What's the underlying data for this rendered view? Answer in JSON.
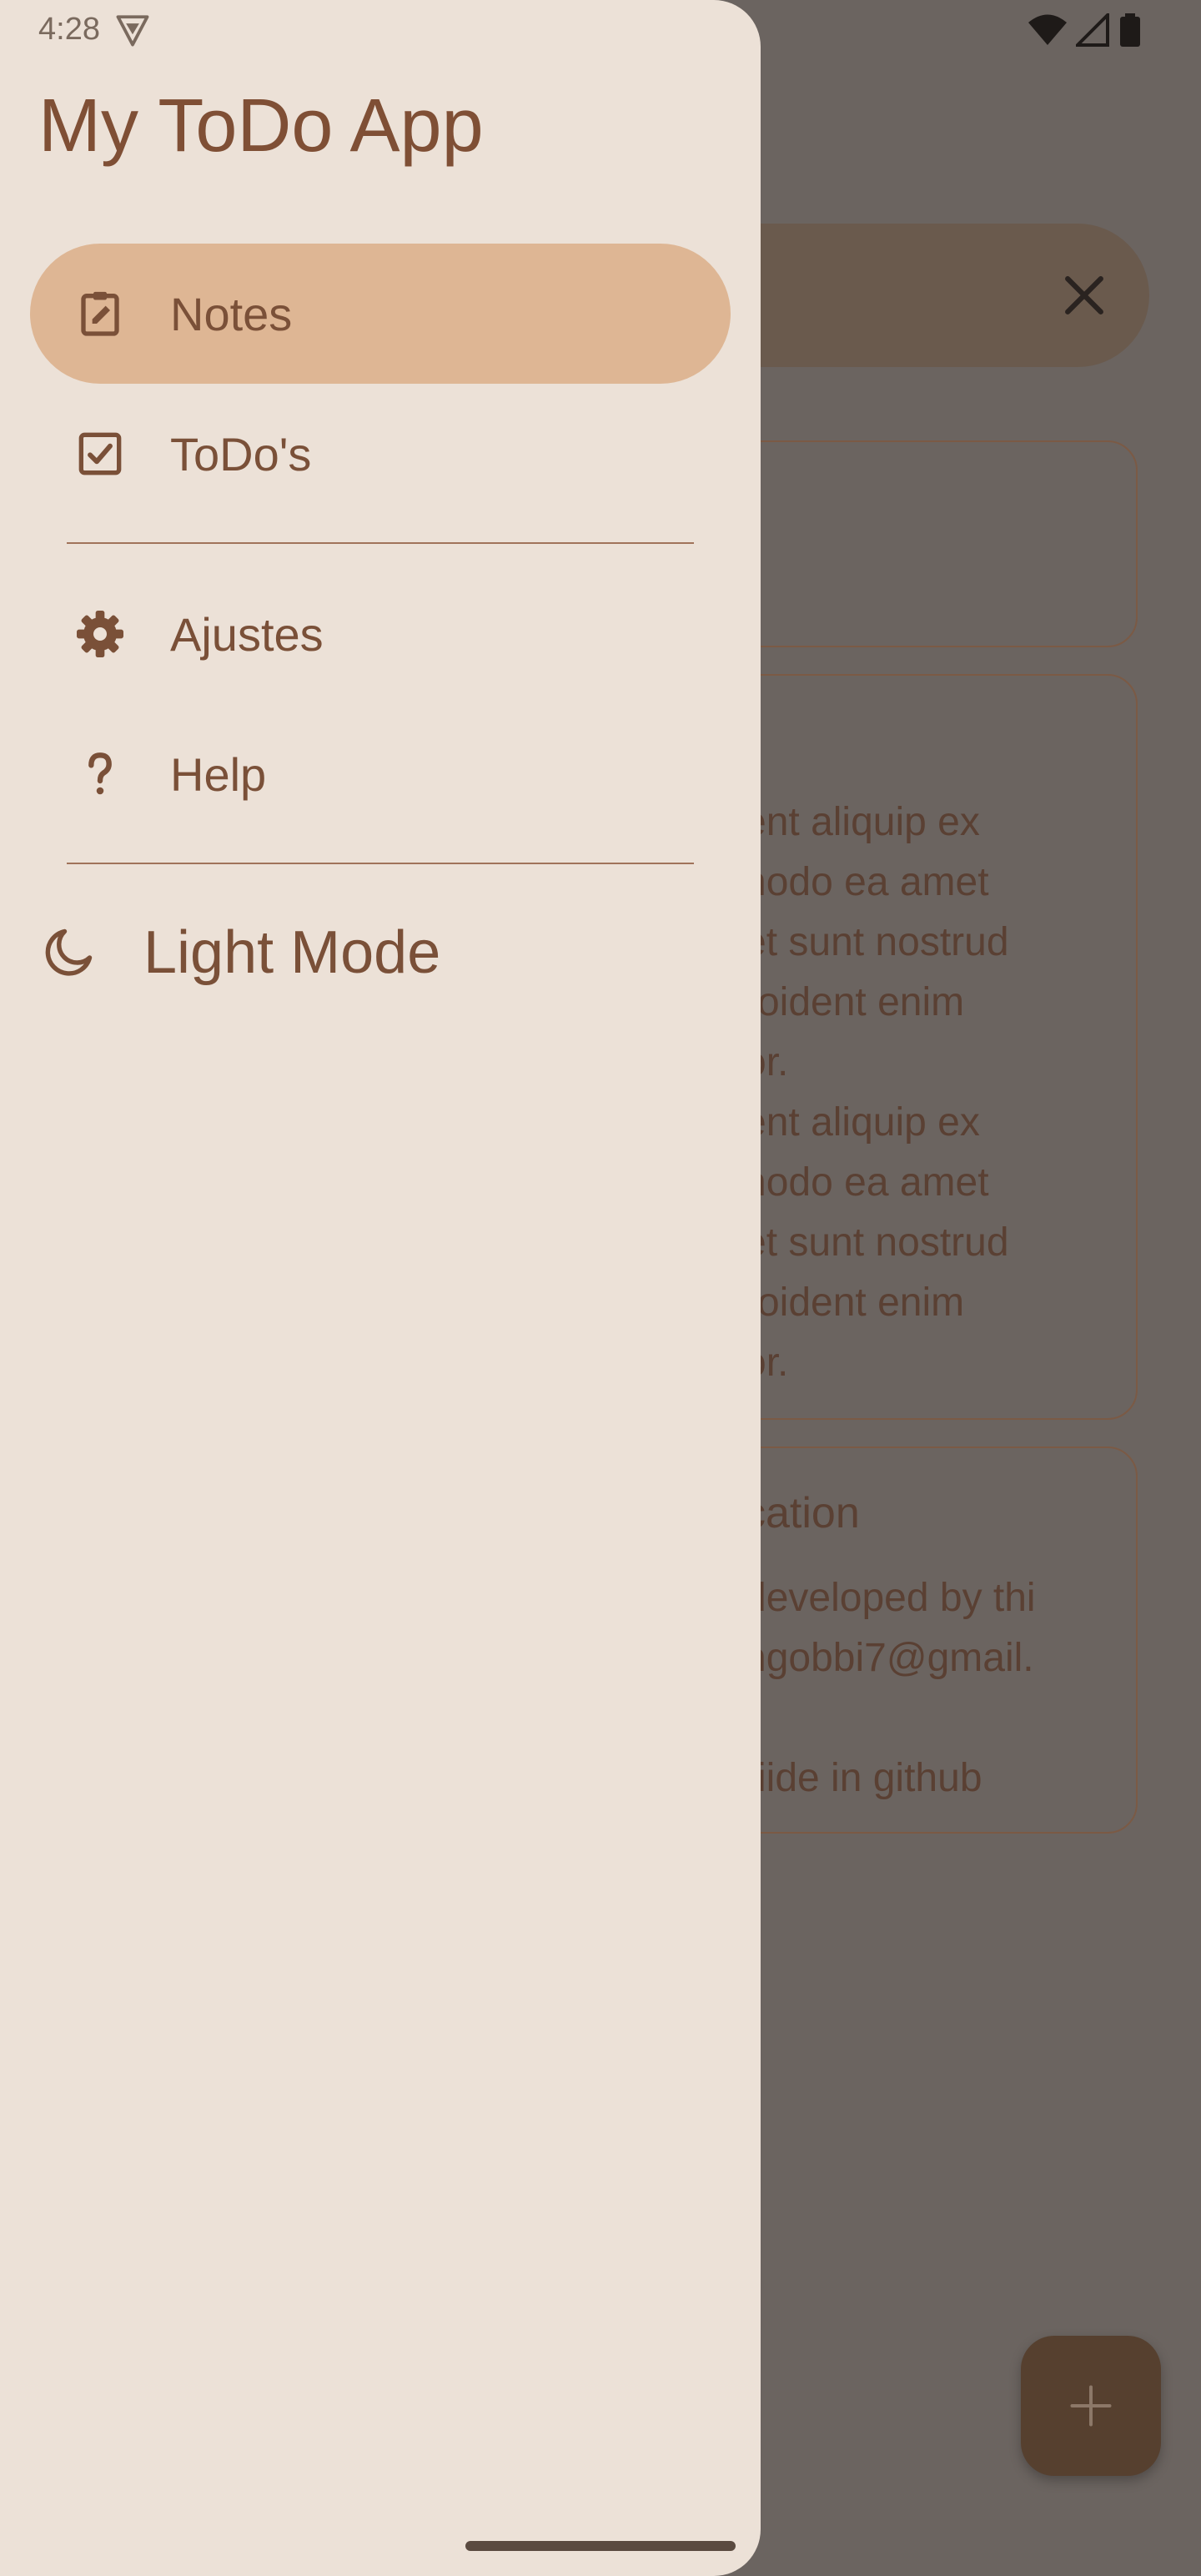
{
  "status_bar": {
    "time": "4:28"
  },
  "drawer": {
    "title": "My ToDo App",
    "items": [
      {
        "label": "Notes",
        "icon": "note-edit-icon",
        "selected": true
      },
      {
        "label": "ToDo's",
        "icon": "checkbox-icon",
        "selected": false
      },
      {
        "label": "Ajustes",
        "icon": "gear-icon",
        "selected": false
      },
      {
        "label": "Help",
        "icon": "question-icon",
        "selected": false
      }
    ],
    "theme_toggle": {
      "label": "Light Mode",
      "icon": "moon-icon"
    }
  },
  "background": {
    "card2_lines": "ent aliquip ex\nnodo ea amet\net sunt nostrud\nroident enim\nor.\nent aliquip ex\nnodo ea amet\net sunt nostrud\nroident enim\nor.",
    "card3_title": "cation",
    "card3_lines": "developed by thi\nngobbi7@gmail.\n\nriide in github"
  },
  "colors": {
    "drawer_bg": "#ece1d7",
    "selected_bg": "#deb694",
    "accent_text": "#7f4f35",
    "scrim": "#6b6460"
  }
}
